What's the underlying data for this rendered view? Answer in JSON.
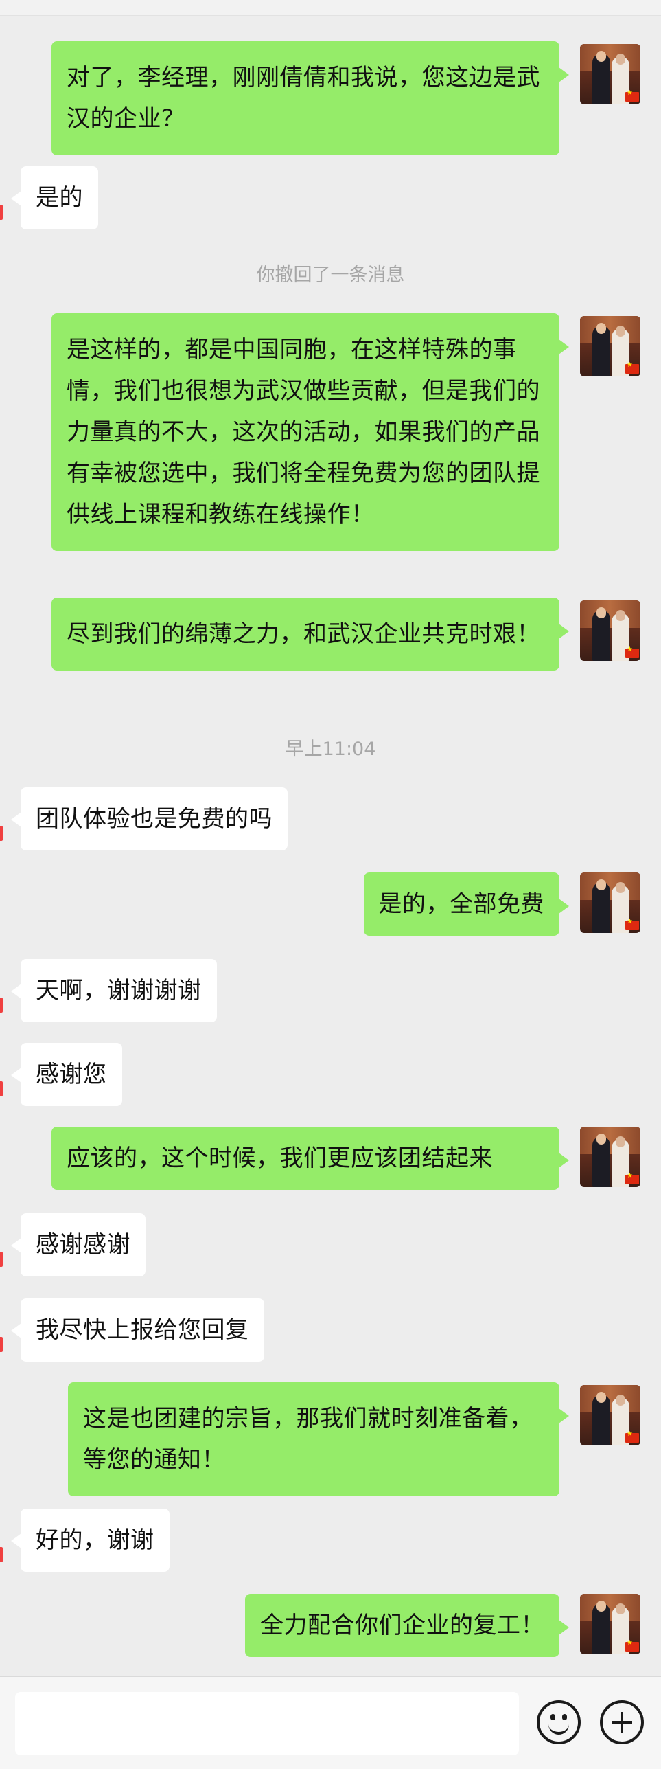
{
  "messages": {
    "m1": {
      "sender": "me",
      "text": "对了，李经理，刚刚倩倩和我说，您这边是武汉的企业？"
    },
    "m2": {
      "sender": "them",
      "text": "是的"
    },
    "sys1": {
      "type": "system",
      "text": "你撤回了一条消息"
    },
    "m3": {
      "sender": "me",
      "text": "是这样的，都是中国同胞，在这样特殊的事情，我们也很想为武汉做些贡献，但是我们的力量真的不大，这次的活动，如果我们的产品有幸被您选中，我们将全程免费为您的团队提供线上课程和教练在线操作！"
    },
    "m4": {
      "sender": "me",
      "text": "尽到我们的绵薄之力，和武汉企业共克时艰！"
    },
    "time1": {
      "type": "timestamp",
      "text": "早上11:04"
    },
    "m5": {
      "sender": "them",
      "text": "团队体验也是免费的吗"
    },
    "m6": {
      "sender": "me",
      "text": "是的，全部免费"
    },
    "m7": {
      "sender": "them",
      "text": "天啊，谢谢谢谢"
    },
    "m8": {
      "sender": "them",
      "text": "感谢您"
    },
    "m9": {
      "sender": "me",
      "text": "应该的，这个时候，我们更应该团结起来"
    },
    "m10": {
      "sender": "them",
      "text": "感谢感谢"
    },
    "m11": {
      "sender": "them",
      "text": "我尽快上报给您回复"
    },
    "m12": {
      "sender": "me",
      "text": "这是也团建的宗旨，那我们就时刻准备着，等您的通知！"
    },
    "m13": {
      "sender": "them",
      "text": "好的，谢谢"
    },
    "m14": {
      "sender": "me",
      "text": "全力配合你们企业的复工！"
    }
  },
  "input_bar": {
    "value": "",
    "emoji_icon": "emoji-icon",
    "plus_icon": "plus-icon"
  },
  "colors": {
    "background": "#ededed",
    "my_bubble": "#95ec69",
    "their_bubble": "#ffffff",
    "system_text": "#a6a6a6",
    "unread_mark": "#f04040"
  }
}
